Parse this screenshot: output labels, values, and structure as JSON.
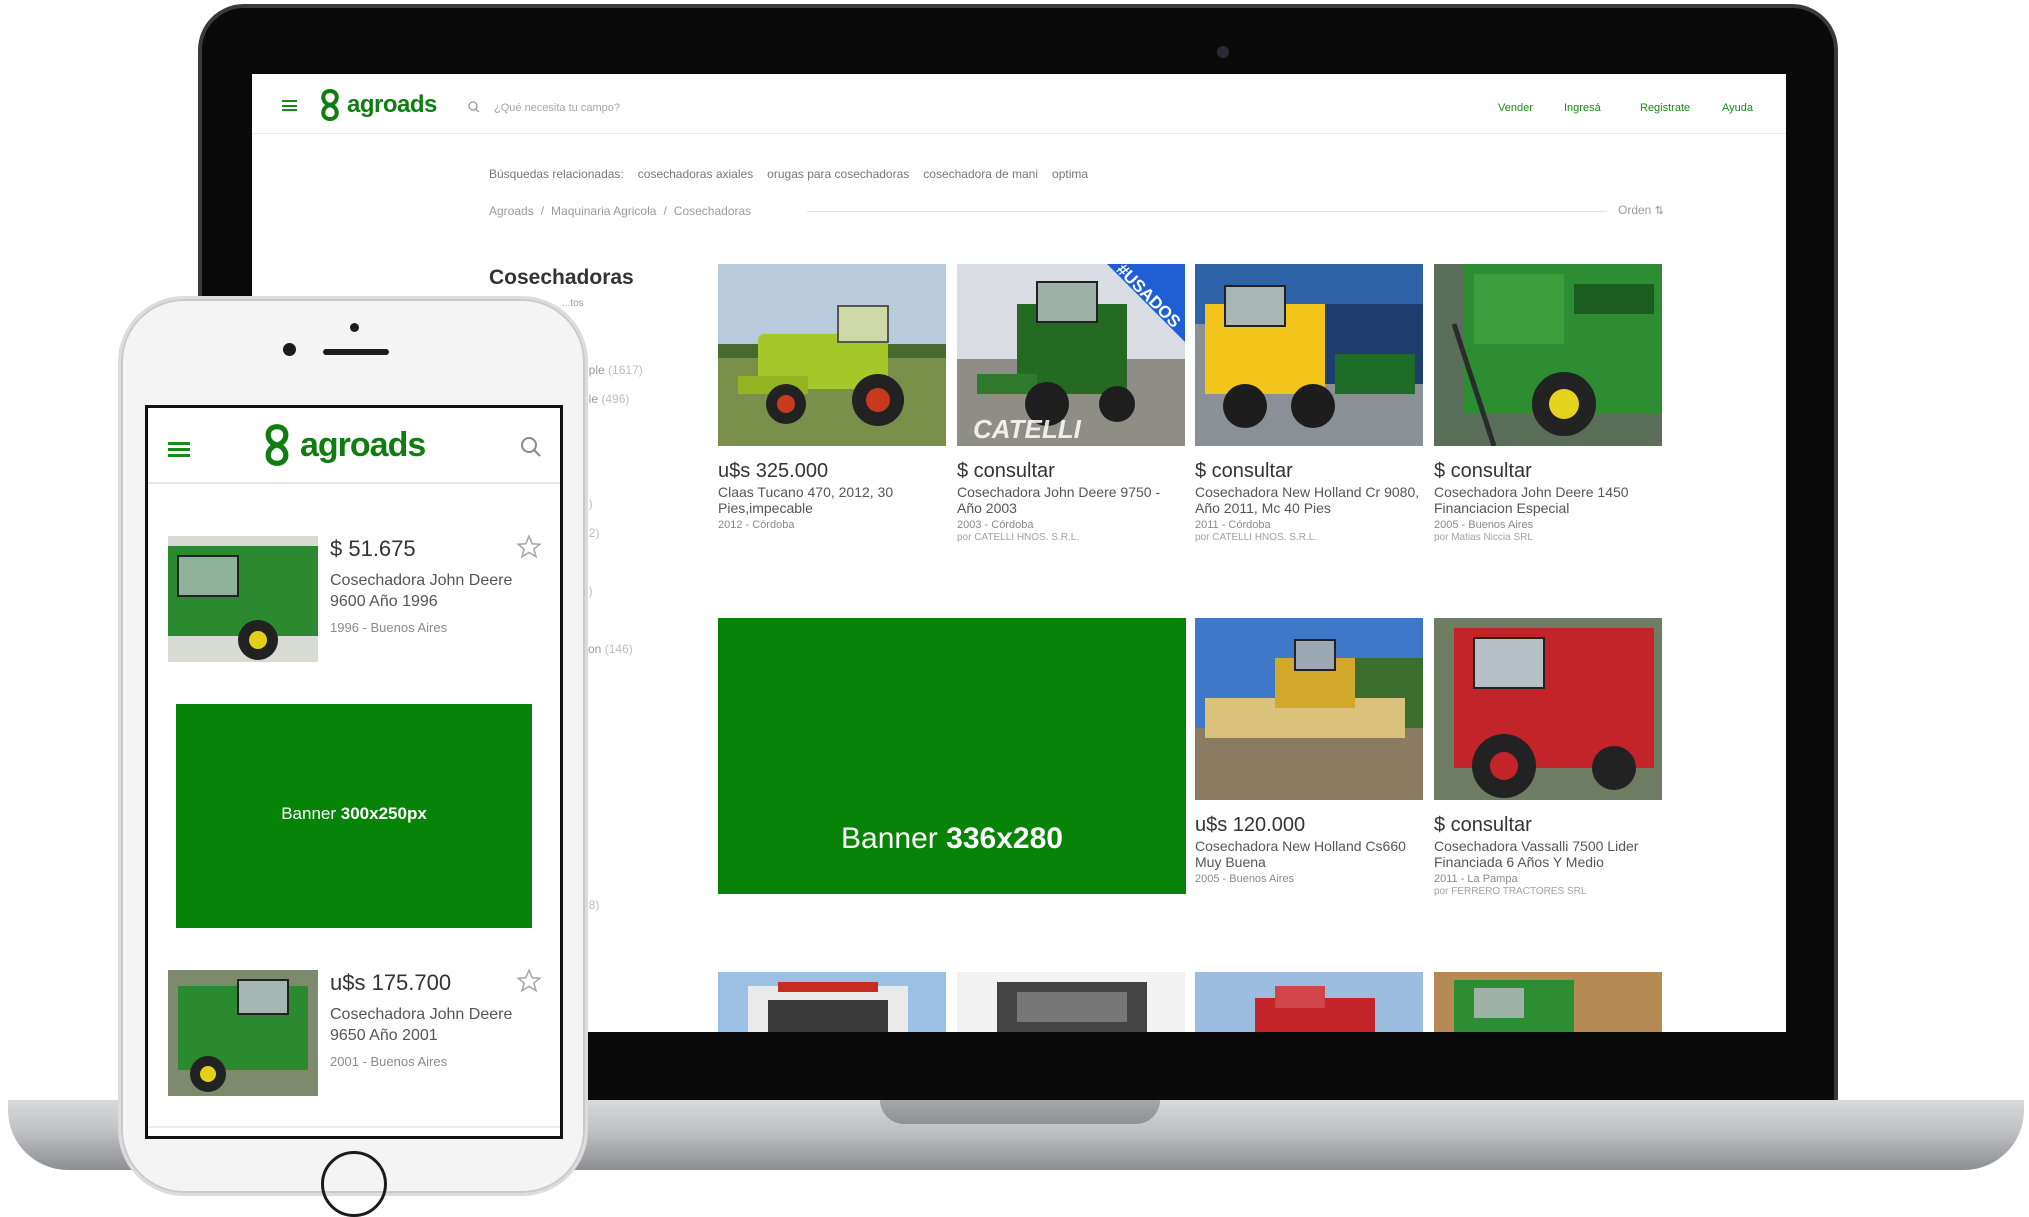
{
  "desktop": {
    "logo": "agroads",
    "search_placeholder": "¿Qué necesita tu campo?",
    "nav": [
      "Vender",
      "Ingresá",
      "Registrate",
      "Ayuda"
    ],
    "related_label": "Búsquedas relacionadas:",
    "related": [
      "cosechadoras axiales",
      "orugas para cosechadoras",
      "cosechadora de mani",
      "optima"
    ],
    "breadcrumb": [
      "Agroads",
      "/",
      "Maquinaria Agricola",
      "/",
      "Cosechadoras"
    ],
    "sort_label": "Orden",
    "title": "Cosechadoras",
    "title_sub": "...tos",
    "sidebar_fragments": [
      {
        "text": "nple",
        "count": "(1617)"
      },
      {
        "text": "ble",
        "count": "(496)"
      },
      {
        "text": "",
        "count": "2)"
      },
      {
        "text": "",
        "count": "12)"
      },
      {
        "text": "",
        "count": "8)"
      },
      {
        "text": "son",
        "count": "(146)"
      },
      {
        "text": "",
        "count": "68)"
      },
      {
        "text": "",
        "count": ")"
      }
    ],
    "listings": [
      {
        "price": "u$s 325.000",
        "title": "Claas Tucano 470, 2012, 30 Pies,impecable",
        "meta": "2012 - Córdoba",
        "seller": ""
      },
      {
        "price": "$ consultar",
        "title": "Cosechadora John Deere 9750 - Año 2003",
        "meta": "2003 - Córdoba",
        "seller": "por CATELLI HNOS. S.R.L.",
        "badge": "#USADOS",
        "watermark": "CATELLI"
      },
      {
        "price": "$ consultar",
        "title": "Cosechadora New Holland Cr 9080, Año 2011, Mc 40 Pies",
        "meta": "2011 - Córdoba",
        "seller": "por CATELLI HNOS. S.R.L."
      },
      {
        "price": "$ consultar",
        "title": "Cosechadora John Deere 1450 Financiacion Especial",
        "meta": "2005 - Buenos Aires",
        "seller": "por Matias Niccia SRL"
      },
      {
        "price": "u$s 120.000",
        "title": "Cosechadora New Holland Cs660 Muy Buena",
        "meta": "2005 - Buenos Aires",
        "seller": ""
      },
      {
        "price": "$ consultar",
        "title": "Cosechadora Vassalli 7500 Lider Financiada 6 Años Y Medio",
        "meta": "2011 - La Pampa",
        "seller": "por FERRERO TRACTORES SRL"
      }
    ],
    "banner": {
      "label": "Banner",
      "size": "336x280"
    }
  },
  "mobile": {
    "logo": "agroads",
    "items": [
      {
        "price": "$ 51.675",
        "title": "Cosechadora John Deere 9600 Año 1996",
        "meta": "1996 - Buenos Aires"
      },
      {
        "price": "u$s 175.700",
        "title": "Cosechadora John Deere 9650 Año 2001",
        "meta": "2001 - Buenos Aires"
      }
    ],
    "banner": {
      "label": "Banner",
      "size": "300x250px"
    }
  },
  "colors": {
    "brand_green": "#0f7d0f",
    "banner_green": "#078307",
    "link_green": "#178a17"
  }
}
